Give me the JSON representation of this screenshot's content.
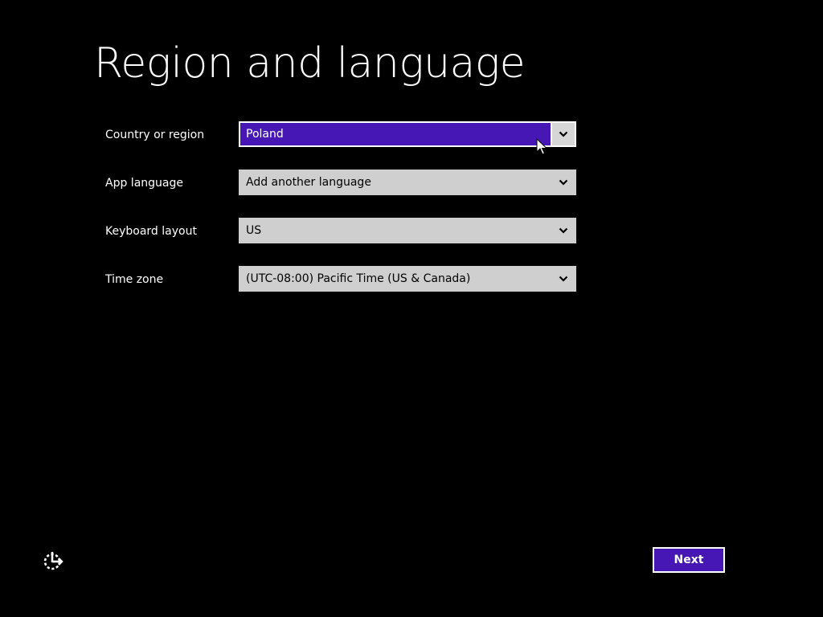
{
  "page": {
    "title": "Region and language"
  },
  "fields": [
    {
      "label": "Country or region",
      "value": "Poland"
    },
    {
      "label": "App language",
      "value": "Add another language"
    },
    {
      "label": "Keyboard layout",
      "value": "US"
    },
    {
      "label": "Time zone",
      "value": "(UTC-08:00) Pacific Time (US & Canada)"
    }
  ],
  "footer": {
    "next_label": "Next"
  },
  "icons": {
    "dropdown": "chevron-down-icon",
    "accessibility": "ease-of-access-icon",
    "pointer": "mouse-cursor-icon"
  },
  "colors": {
    "background": "#000000",
    "accent": "#4617b4",
    "field_background": "#cfcfcf",
    "text": "#ffffff"
  }
}
